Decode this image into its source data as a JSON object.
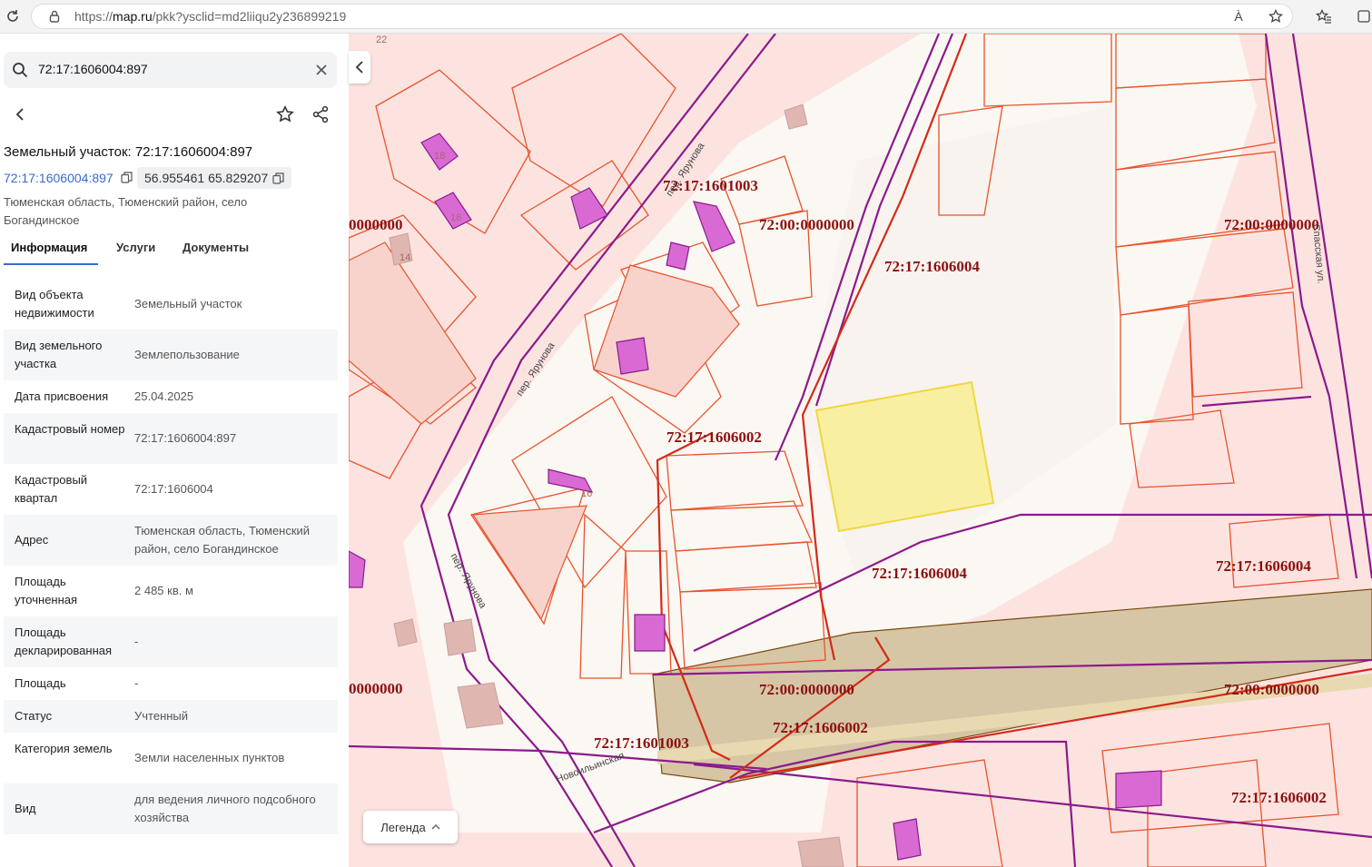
{
  "browser": {
    "url_prefix": "https://",
    "url_host": "map.ru",
    "url_path": "/pkk?ysclid=md2liiqu2y236899219",
    "read_aloud_label": "À"
  },
  "search": {
    "value": "72:17:1606004:897"
  },
  "header": {
    "title": "Земельный участок: 72:17:1606004:897",
    "cadastral_link": "72:17:1606004:897",
    "coordinates": "56.955461 65.829207",
    "address": "Тюменская область, Тюменский район, село Богандинское"
  },
  "tabs": [
    {
      "label": "Информация"
    },
    {
      "label": "Услуги"
    },
    {
      "label": "Документы"
    }
  ],
  "info_rows": [
    {
      "label": "Вид объекта недвижимости",
      "value": "Земельный участок"
    },
    {
      "label": "Вид земельного участка",
      "value": "Землепользование"
    },
    {
      "label": "Дата присвоения",
      "value": "25.04.2025"
    },
    {
      "label": "Кадастровый номер",
      "value": "72:17:1606004:897"
    },
    {
      "label": "Кадастровый квартал",
      "value": "72:17:1606004"
    },
    {
      "label": "Адрес",
      "value": "Тюменская область, Тюменский район, село Богандинское"
    },
    {
      "label": "Площадь уточненная",
      "value": "2 485 кв. м"
    },
    {
      "label": "Площадь декларированная",
      "value": "-"
    },
    {
      "label": "Площадь",
      "value": "-"
    },
    {
      "label": "Статус",
      "value": "Учтенный"
    },
    {
      "label": "Категория земель",
      "value": "Земли населенных пунктов"
    },
    {
      "label": "Вид",
      "value": "для ведения личного подсобного хозяйства"
    }
  ],
  "map": {
    "labels": [
      "72:17:1601003",
      "72:00:0000000",
      "72:17:1606004",
      "72:00:0000000",
      "0000000",
      "72:17:1606002",
      "72:17:1606004",
      "72:17:1606004",
      "0000000",
      "72:00:0000000",
      "72:00:0000000",
      "72:17:1606002",
      "72:17:1601003",
      "72:17:1606002"
    ],
    "streets": [
      "пер. Ярунова",
      "пер. Ярунова",
      "пер. Ярунова",
      "Новоильинская",
      "Спасская ул."
    ],
    "house_numbers": [
      "18",
      "16",
      "14",
      "16",
      "22"
    ]
  },
  "legend": {
    "label": "Легенда"
  },
  "colors": {
    "parcel_fill": "#fde3e0",
    "parcel_border": "#e8532b",
    "quarter_border": "#8b1a8b",
    "selected_fill": "#f8f0a0",
    "selected_border": "#f0d640",
    "building_fill": "#d96ad3",
    "road_fill": "#d6c6a6",
    "accent": "#3869d4",
    "label_color": "#8b1111"
  }
}
